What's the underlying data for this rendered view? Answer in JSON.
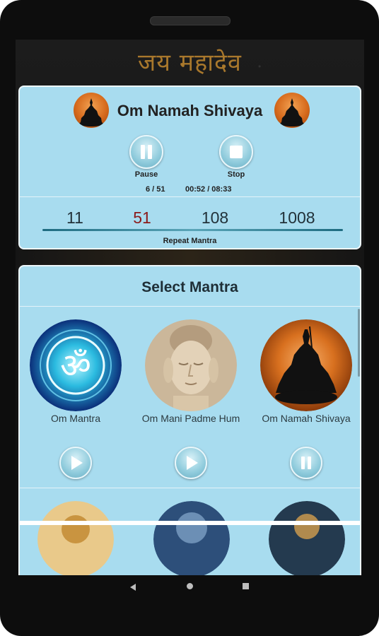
{
  "app": {
    "banner_title": "जय महादेव"
  },
  "player": {
    "title": "Om Namah Shivaya",
    "pause_label": "Pause",
    "stop_label": "Stop",
    "count_progress": "6 / 51",
    "time_progress": "00:52 / 08:33",
    "repeat_options": [
      "11",
      "51",
      "108",
      "1008"
    ],
    "selected_repeat": "51",
    "repeat_label": "Repeat Mantra",
    "seek_progress_fraction": 0.1
  },
  "select": {
    "title": "Select Mantra",
    "mantras": [
      {
        "name": "Om Mantra",
        "image": "om-symbol-image",
        "action_icon": "play-icon"
      },
      {
        "name": "Om Mani Padme Hum",
        "image": "buddha-face-image",
        "action_icon": "play-icon"
      },
      {
        "name": "Om Namah Shivaya",
        "image": "shiva-silhouette-image",
        "action_icon": "pause-icon"
      }
    ]
  },
  "nav": {
    "back_icon": "back-icon",
    "home_icon": "home-icon",
    "recent_icon": "recent-apps-icon"
  },
  "colors": {
    "card_bg": "#a8dcef",
    "banner_gold": "#a9782c",
    "selected_repeat": "#8a1a1a"
  }
}
